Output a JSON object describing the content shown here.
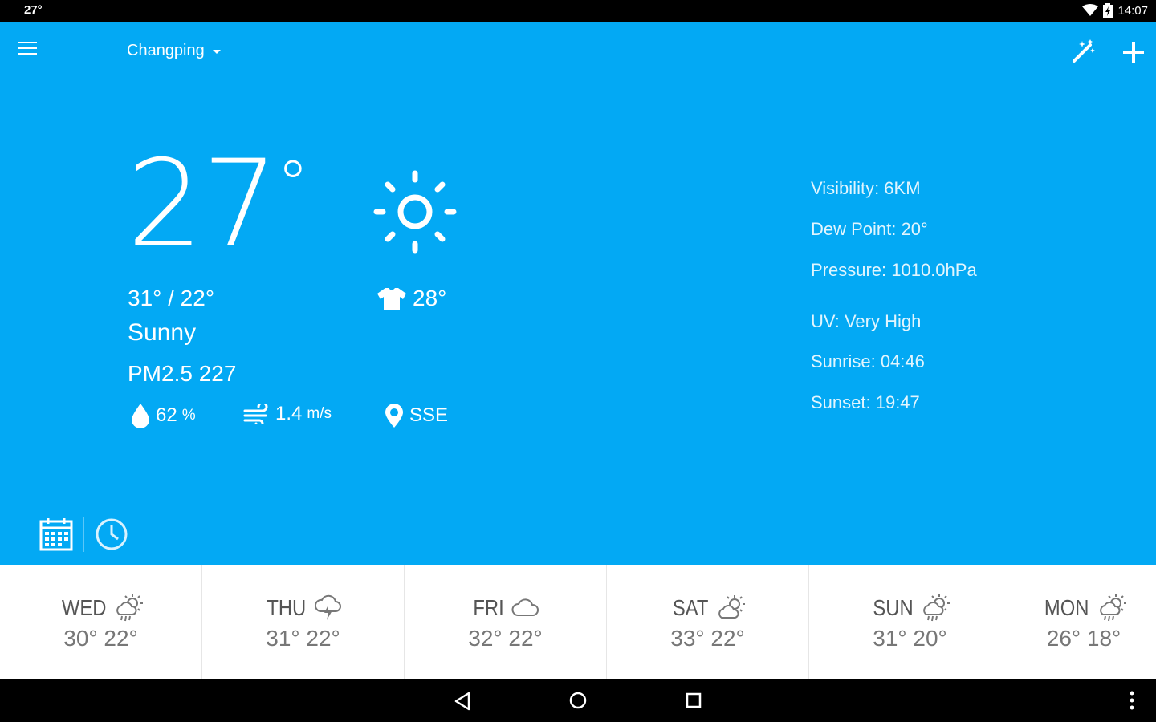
{
  "status_bar": {
    "temperature": "27°",
    "time": "14:07",
    "icons": [
      "wifi-icon",
      "battery-charging-icon"
    ]
  },
  "app_bar": {
    "location": "Changping",
    "icons": [
      "menu-icon",
      "magic-wand-icon",
      "add-icon"
    ]
  },
  "current": {
    "temperature": "27",
    "temperature_unit": "°",
    "high_low": "31° / 22°",
    "condition": "Sunny",
    "pm25": "PM2.5 227",
    "feels_like": "28°",
    "humidity_value": "62",
    "humidity_unit": "%",
    "wind_value": "1.4",
    "wind_unit": "m/s",
    "wind_direction": "SSE",
    "condition_icon": "sun-icon"
  },
  "details": {
    "visibility": "Visibility: 6KM",
    "dew_point": "Dew Point: 20°",
    "pressure": "Pressure: 1010.0hPa",
    "uv": "UV: Very High",
    "sunrise": "Sunrise: 04:46",
    "sunset": "Sunset: 19:47"
  },
  "view_toggle": {
    "icons": [
      "calendar-icon",
      "clock-icon"
    ],
    "selected": "calendar"
  },
  "forecast": [
    {
      "day": "WED",
      "temps": "30° 22°",
      "icon": "partly-sunny-rain-icon"
    },
    {
      "day": "THU",
      "temps": "31° 22°",
      "icon": "thunderstorm-icon"
    },
    {
      "day": "FRI",
      "temps": "32° 22°",
      "icon": "cloudy-icon"
    },
    {
      "day": "SAT",
      "temps": "33° 22°",
      "icon": "partly-cloudy-icon"
    },
    {
      "day": "SUN",
      "temps": "31° 20°",
      "icon": "partly-sunny-rain-icon"
    },
    {
      "day": "MON",
      "temps": "26° 18°",
      "icon": "partly-sunny-rain-icon"
    }
  ],
  "nav_bar": {
    "icons": [
      "back-icon",
      "home-icon",
      "recents-icon",
      "more-options-icon"
    ]
  },
  "colors": {
    "primary": "#03a9f4",
    "forecast_background": "#ffffff",
    "system_bars": "#000000"
  }
}
